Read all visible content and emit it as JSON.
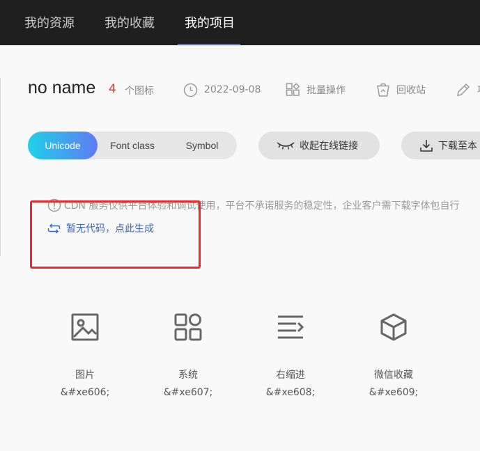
{
  "topnav": {
    "tabs": [
      {
        "label": "我的资源"
      },
      {
        "label": "我的收藏"
      },
      {
        "label": "我的项目",
        "active": true
      }
    ]
  },
  "project": {
    "name": "no name",
    "icon_count": "4",
    "icon_count_label": "个图标",
    "date": "2022-09-08",
    "batch_label": "批量操作",
    "recycle_label": "回收站",
    "more_label": "项"
  },
  "format_tabs": [
    {
      "label": "Unicode",
      "active": true
    },
    {
      "label": "Font class"
    },
    {
      "label": "Symbol"
    }
  ],
  "actions": {
    "collapse_link": "收起在线链接",
    "download": "下载至本"
  },
  "notice": {
    "text": "CDN 服务仅供平台体验和调试使用，平台不承诺服务的稳定性，企业客户需下载字体包自行",
    "generate_link": "暂无代码，点此生成"
  },
  "icons": [
    {
      "name": "图片",
      "code": "&#xe606;",
      "icon": "image-icon"
    },
    {
      "name": "系统",
      "code": "&#xe607;",
      "icon": "grid-icon"
    },
    {
      "name": "右缩进",
      "code": "&#xe608;",
      "icon": "indent-right-icon"
    },
    {
      "name": "微信收藏",
      "code": "&#xe609;",
      "icon": "cube-icon"
    }
  ],
  "colors": {
    "nav_bg": "#1f1f1f",
    "accent_underline": "#5b6cf5",
    "count_red": "#e4302b",
    "link_blue": "#3b62c2",
    "highlight_red": "#e8292b",
    "gradient_start": "#1fd1e8",
    "gradient_end": "#5e7bf5"
  }
}
